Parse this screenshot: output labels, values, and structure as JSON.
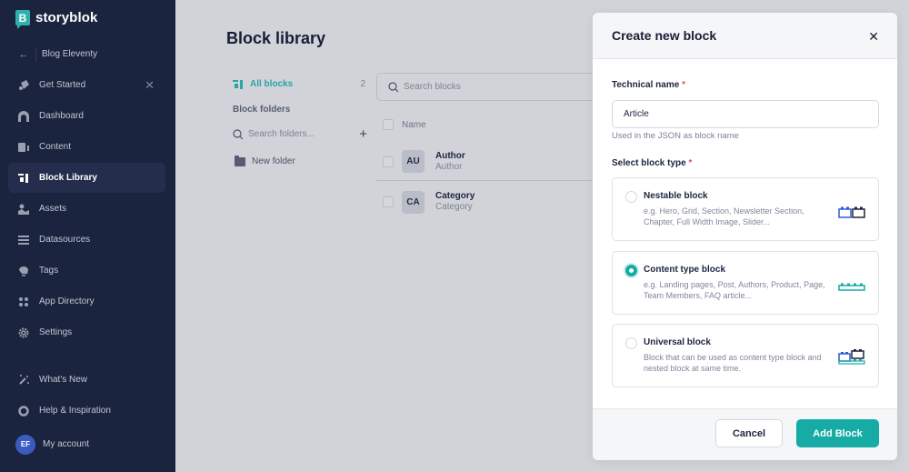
{
  "brand": {
    "name": "storyblok",
    "logo_letter": "B",
    "accent": "#16aca5"
  },
  "sidebar": {
    "back": {
      "label": "Blog Eleventy",
      "icon": "arrow-left-icon"
    },
    "items": [
      {
        "label": "Get Started",
        "icon": "rocket-icon",
        "closable": true
      },
      {
        "label": "Dashboard",
        "icon": "dashboard-icon"
      },
      {
        "label": "Content",
        "icon": "content-icon"
      },
      {
        "label": "Block Library",
        "icon": "block-library-icon",
        "active": true
      },
      {
        "label": "Assets",
        "icon": "assets-icon"
      },
      {
        "label": "Datasources",
        "icon": "datasources-icon"
      },
      {
        "label": "Tags",
        "icon": "tag-icon"
      },
      {
        "label": "App Directory",
        "icon": "apps-icon"
      },
      {
        "label": "Settings",
        "icon": "gear-icon"
      }
    ],
    "bottom": [
      {
        "label": "What's New",
        "icon": "magic-wand-icon"
      },
      {
        "label": "Help & Inspiration",
        "icon": "lifebuoy-icon"
      }
    ],
    "account": {
      "initials": "EF",
      "label": "My account"
    }
  },
  "main": {
    "title": "Block library",
    "all_blocks": {
      "label": "All blocks",
      "count": "2"
    },
    "folders_label": "Block folders",
    "search_folders_placeholder": "Search folders...",
    "new_folder": "New folder",
    "search_blocks_placeholder": "Search blocks",
    "column_name": "Name",
    "blocks": [
      {
        "badge": "AU",
        "name": "Author",
        "technical": "Author"
      },
      {
        "badge": "CA",
        "name": "Category",
        "technical": "Category"
      }
    ]
  },
  "modal": {
    "title": "Create new block",
    "technical_name_label": "Technical name",
    "required_mark": "*",
    "technical_name_value": "Article",
    "technical_name_helper": "Used in the JSON as block name",
    "block_type_label": "Select block type",
    "types": [
      {
        "title": "Nestable block",
        "desc": "e.g. Hero, Grid, Section, Newsletter Section, Chapter, Full Width Image, Slider...",
        "selected": false
      },
      {
        "title": "Content type block",
        "desc": "e.g. Landing pages, Post, Authors, Product, Page, Team Members, FAQ article...",
        "selected": true
      },
      {
        "title": "Universal block",
        "desc": "Block that can be used as content type block and nested block at same time.",
        "selected": false
      }
    ],
    "cancel_label": "Cancel",
    "submit_label": "Add Block"
  }
}
